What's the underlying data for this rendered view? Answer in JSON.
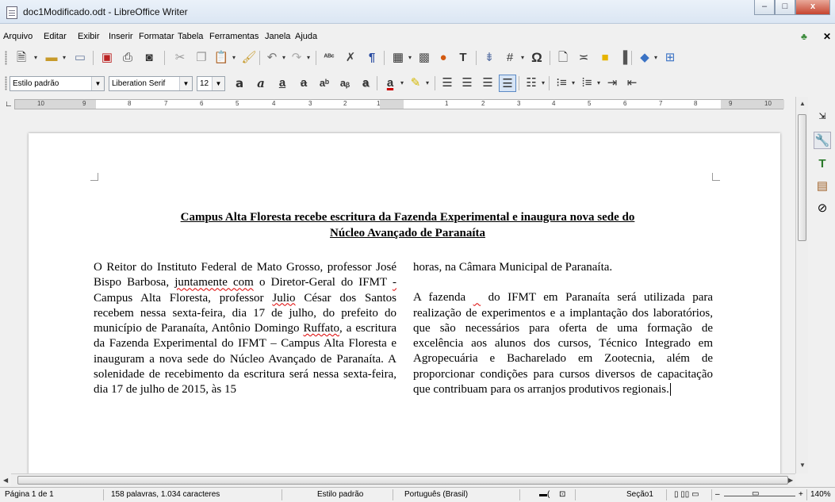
{
  "window": {
    "title": "doc1Modificado.odt - LibreOffice Writer",
    "minimize_glyph": "–",
    "maximize_glyph": "□",
    "close_glyph": "x"
  },
  "menu": [
    "Arquivo",
    "Editar",
    "Exibir",
    "Inserir",
    "Formatar",
    "Tabela",
    "Ferramentas",
    "Janela",
    "Ajuda"
  ],
  "format_toolbar": {
    "paragraph_style": "Estilo padrão",
    "font_name": "Liberation Serif",
    "font_size": "12"
  },
  "ruler": {
    "left_numbers": [
      "10",
      "9",
      "8",
      "7",
      "6",
      "5",
      "4",
      "3",
      "2",
      "1"
    ],
    "right_numbers": [
      "1",
      "2",
      "3",
      "4",
      "5",
      "6",
      "7",
      "8",
      "9",
      "10"
    ]
  },
  "document": {
    "title_line1": "Campus Alta Floresta recebe escritura da Fazenda Experimental e inaugura nova sede do",
    "title_line2": "Núcleo Avançado de Paranaíta",
    "col1": {
      "p1_a": "O Reitor do Instituto Federal de Mato Grosso, professor José Bispo Barbosa, ",
      "p1_b": "juntamente com",
      "p1_c": " o Diretor-Geral do IFMT ",
      "p1_d": "- ",
      "p1_e": "Campus Alta Floresta, professor ",
      "p1_f": "Julio",
      "p1_g": " César dos Santos recebem nessa sexta-feira, dia 17 de julho, do prefeito do município de Paranaíta, Antônio Domingo ",
      "p1_h": "Ruffato",
      "p1_i": ", a escritura da Fazenda Experimental do IFMT – Campus Alta Floresta e inauguram a nova sede do Núcleo Avançado de Paranaíta. A solenidade de recebimento da escritura será nessa sexta-feira, dia 17 de julho de 2015, às 15"
    },
    "col2": {
      "p1": "horas, na Câmara Municipal de Paranaíta.",
      "p2_a": "A fazenda ",
      "p2_b": " do IFMT em Paranaíta será utilizada para realização de experimentos e a implantação dos laboratórios, que são necessários para oferta de uma formação de excelência aos alunos dos cursos, Técnico Integrado em Agropecuária e Bacharelado em Zootecnia, além de proporcionar condições para cursos diversos de capacitação que contribuam para os arranjos produtivos regionais."
    }
  },
  "status": {
    "page": "Página 1 de 1",
    "words": "158 palavras, 1.034 caracteres",
    "style": "Estilo padrão",
    "language": "Português (Brasil)",
    "section": "Seção1",
    "zoom": "140%",
    "zoom_minus": "–",
    "zoom_plus": "+"
  },
  "icons": [
    "document-icon",
    "new-document-icon",
    "open-icon",
    "save-icon",
    "export-pdf-icon",
    "print-icon",
    "print-preview-icon",
    "cut-icon",
    "copy-icon",
    "paste-icon",
    "clone-formatting-icon",
    "undo-icon",
    "redo-icon",
    "spellcheck-icon",
    "autocorrect-icon",
    "formatting-marks-icon",
    "table-icon",
    "image-icon",
    "chart-icon",
    "text-box-icon",
    "page-break-icon",
    "field-icon",
    "special-character-icon",
    "hyperlink-icon",
    "footnote-icon",
    "comment-icon",
    "track-changes-icon",
    "shapes-icon",
    "bold-icon",
    "italic-icon",
    "underline-icon",
    "strikethrough-icon",
    "superscript-icon",
    "subscript-icon",
    "shadow-icon",
    "font-color-icon",
    "highlight-icon",
    "align-left-icon",
    "align-center-icon",
    "align-right-icon",
    "justify-icon",
    "line-spacing-icon",
    "bullets-icon",
    "numbering-icon",
    "indent-icon",
    "outdent-icon",
    "properties-icon",
    "styles-icon",
    "gallery-icon",
    "navigator-icon"
  ]
}
